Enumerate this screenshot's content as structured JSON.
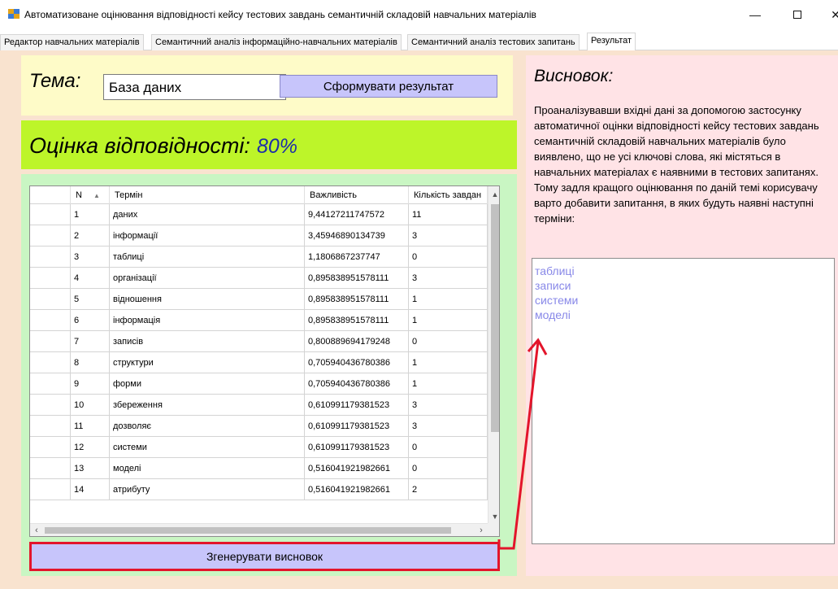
{
  "window": {
    "title": "Автоматизоване оцінювання відповідності кейсу тестових завдань семантичній складовій навчальних матеріалів",
    "icon": "app-icon",
    "controls": {
      "minimize": "—",
      "maximize": "",
      "close": "✕"
    }
  },
  "tabs": [
    {
      "label": "Редактор навчальних матеріалів",
      "active": false
    },
    {
      "label": "Семантичний аналіз інформаційно-навчальних матеріалів",
      "active": false
    },
    {
      "label": "Семантичний аналіз тестових запитань",
      "active": false
    },
    {
      "label": "Результат",
      "active": true
    }
  ],
  "topic": {
    "label": "Тема:",
    "value": "База даних",
    "form_button": "Сформувати результат"
  },
  "score": {
    "label": "Оцінка відповідності:",
    "value": "80%"
  },
  "table": {
    "columns": [
      "",
      "N",
      "Термін",
      "Важливість",
      "Кількість завдан"
    ],
    "rows": [
      [
        "",
        "1",
        "даних",
        "9,44127211747572",
        "11"
      ],
      [
        "",
        "2",
        "інформації",
        "3,45946890134739",
        "3"
      ],
      [
        "",
        "3",
        "таблиці",
        "1,1806867237747",
        "0"
      ],
      [
        "",
        "4",
        "організації",
        "0,895838951578111",
        "3"
      ],
      [
        "",
        "5",
        "відношення",
        "0,895838951578111",
        "1"
      ],
      [
        "",
        "6",
        "інформація",
        "0,895838951578111",
        "1"
      ],
      [
        "",
        "7",
        "записів",
        "0,800889694179248",
        "0"
      ],
      [
        "",
        "8",
        "структури",
        "0,705940436780386",
        "1"
      ],
      [
        "",
        "9",
        "форми",
        "0,705940436780386",
        "1"
      ],
      [
        "",
        "10",
        "збереження",
        "0,610991179381523",
        "3"
      ],
      [
        "",
        "11",
        "дозволяє",
        "0,610991179381523",
        "3"
      ],
      [
        "",
        "12",
        "системи",
        "0,610991179381523",
        "0"
      ],
      [
        "",
        "13",
        "моделі",
        "0,516041921982661",
        "0"
      ],
      [
        "",
        "14",
        "атрибуту",
        "0,516041921982661",
        "2"
      ]
    ],
    "sort_icon": "sort-ascending-icon"
  },
  "generate_button": "Згенерувати висновок",
  "conclusion": {
    "title": "Висновок:",
    "text": "Проаналізувавши вхідні дані за допомогою застосунку автоматичної оцінки відповідності кейсу тестових завдань семантичній складовій навчальних матеріалів було виявлено, що не усі ключові слова, які містяться  в навчальних матеріалах є наявними в тестових запитанях. Тому задля кращого оцінювання по даній темі корисувачу варто добавити запитання, в яких будуть наявні наступні терміни:",
    "terms": [
      "таблиці",
      "записи",
      "системи",
      "моделі"
    ]
  },
  "colors": {
    "background": "#f9e3cf",
    "topic_panel": "#fefbc8",
    "score_panel": "#bdf529",
    "table_panel": "#c9f6c3",
    "conclusion_panel": "#ffe3e6",
    "button": "#c7c5fb",
    "highlight": "#e3152b",
    "score_value": "#1d2ea8",
    "terms": "#8888e8"
  }
}
